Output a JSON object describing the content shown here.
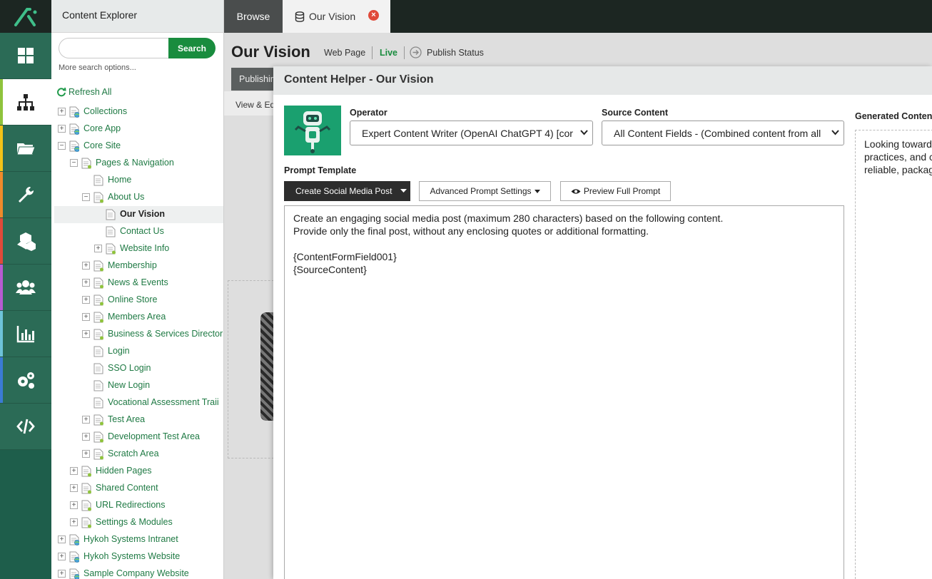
{
  "rail": {
    "items": [
      {
        "icon": "dashboard-icon",
        "stripe": "#2b6b56"
      },
      {
        "icon": "sitemap-icon",
        "stripe": "#8fc33c",
        "active": true
      },
      {
        "icon": "folder-icon",
        "stripe": "#f2c318"
      },
      {
        "icon": "wrench-icon",
        "stripe": "#f08a2b"
      },
      {
        "icon": "cubes-icon",
        "stripe": "#e04a3a"
      },
      {
        "icon": "users-icon",
        "stripe": "#b65bd1"
      },
      {
        "icon": "chart-icon",
        "stripe": "#6ec3d9"
      },
      {
        "icon": "cogs-icon",
        "stripe": "#3b7bd4"
      },
      {
        "icon": "code-icon",
        "stripe": "#2b6b56"
      }
    ]
  },
  "explorer": {
    "title": "Content Explorer",
    "search_button": "Search",
    "search_value": "",
    "more_options": "More search options...",
    "refresh": "Refresh All"
  },
  "tree": [
    {
      "label": "Collections",
      "level": 0,
      "exp": "+"
    },
    {
      "label": "Core App",
      "level": 0,
      "exp": "+"
    },
    {
      "label": "Core Site",
      "level": 0,
      "exp": "-"
    },
    {
      "label": "Pages & Navigation",
      "level": 1,
      "exp": "-"
    },
    {
      "label": "Home",
      "level": 2,
      "exp": ""
    },
    {
      "label": "About Us",
      "level": 2,
      "exp": "-"
    },
    {
      "label": "Our Vision",
      "level": 3,
      "exp": "",
      "selected": true
    },
    {
      "label": "Contact Us",
      "level": 3,
      "exp": ""
    },
    {
      "label": "Website Info",
      "level": 3,
      "exp": "+"
    },
    {
      "label": "Membership",
      "level": 2,
      "exp": "+"
    },
    {
      "label": "News & Events",
      "level": 2,
      "exp": "+"
    },
    {
      "label": "Online Store",
      "level": 2,
      "exp": "+"
    },
    {
      "label": "Members Area",
      "level": 2,
      "exp": "+"
    },
    {
      "label": "Business & Services Director",
      "level": 2,
      "exp": "+"
    },
    {
      "label": "Login",
      "level": 2,
      "exp": ""
    },
    {
      "label": "SSO Login",
      "level": 2,
      "exp": ""
    },
    {
      "label": "New Login",
      "level": 2,
      "exp": ""
    },
    {
      "label": "Vocational Assessment Traii",
      "level": 2,
      "exp": ""
    },
    {
      "label": "Test Area",
      "level": 2,
      "exp": "+"
    },
    {
      "label": "Development Test Area",
      "level": 2,
      "exp": "+"
    },
    {
      "label": "Scratch Area",
      "level": 2,
      "exp": "+"
    },
    {
      "label": "Hidden Pages",
      "level": 1,
      "exp": "+"
    },
    {
      "label": "Shared Content",
      "level": 1,
      "exp": "+"
    },
    {
      "label": "URL Redirections",
      "level": 1,
      "exp": "+"
    },
    {
      "label": "Settings & Modules",
      "level": 1,
      "exp": "+"
    },
    {
      "label": "Hykoh Systems Intranet",
      "level": 0,
      "exp": "+"
    },
    {
      "label": "Hykoh Systems Website",
      "level": 0,
      "exp": "+"
    },
    {
      "label": "Sample Company Website",
      "level": 0,
      "exp": "+"
    }
  ],
  "tabs": {
    "browse": "Browse",
    "current": "Our Vision"
  },
  "page": {
    "title": "Our Vision",
    "type": "Web Page",
    "status": "Live",
    "publish_status": "Publish Status",
    "publishing_tab": "Publishing",
    "view_edit": "View & Edit"
  },
  "modal": {
    "title": "Content Helper - Our Vision",
    "operator_label": "Operator",
    "operator_value": "Expert Content Writer (OpenAI ChatGPT 4) [cor",
    "source_label": "Source Content",
    "source_value": "All Content Fields - (Combined content from all",
    "prompt_label": "Prompt Template",
    "template_button": "Create Social Media Post",
    "advanced_button": "Advanced Prompt Settings",
    "preview_button": "Preview Full Prompt",
    "prompt_text": "Create an engaging social media post (maximum 280 characters) based on the following content.\nProvide only the final post, without any enclosing quotes or additional formatting.\n\n{ContentFormField001}\n{SourceContent}",
    "generated_label": "Generated Content",
    "generated_text": "Looking toward\npractices, and c\nreliable, packag"
  }
}
